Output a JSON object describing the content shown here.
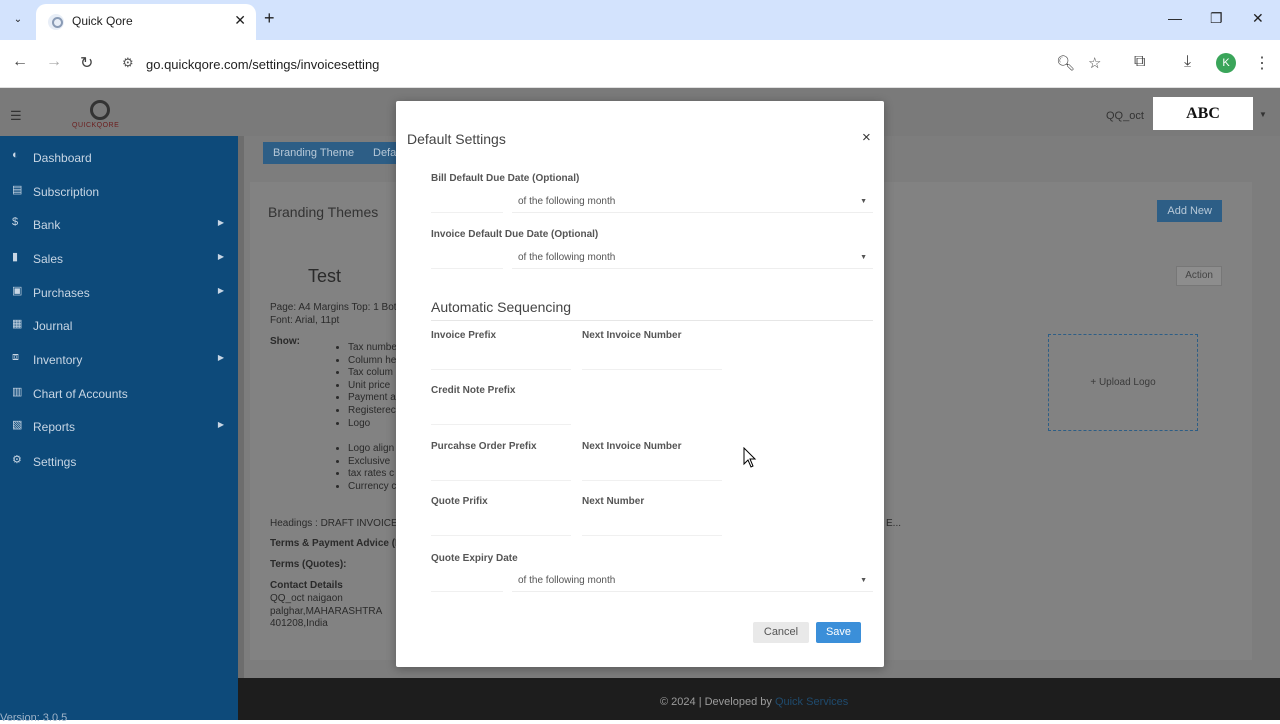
{
  "browser": {
    "tab_title": "Quick Qore",
    "url": "go.quickqore.com/settings/invoicesetting",
    "profile_initial": "K"
  },
  "app": {
    "logo_text": "QUICKQORE",
    "user_name": "QQ_oct",
    "company_badge": "ABC",
    "version": "Version: 3.0.5"
  },
  "sidebar": {
    "items": [
      {
        "label": "Dashboard",
        "icon": "dashboard-icon"
      },
      {
        "label": "Subscription",
        "icon": "subscription-icon"
      },
      {
        "label": "Bank",
        "icon": "dollar-icon"
      },
      {
        "label": "Sales",
        "icon": "bar-chart-icon"
      },
      {
        "label": "Purchases",
        "icon": "purchases-icon"
      },
      {
        "label": "Journal",
        "icon": "journal-icon"
      },
      {
        "label": "Inventory",
        "icon": "inventory-icon"
      },
      {
        "label": "Chart of Accounts",
        "icon": "accounts-icon"
      },
      {
        "label": "Reports",
        "icon": "reports-icon"
      },
      {
        "label": "Settings",
        "icon": "gear-icon"
      }
    ]
  },
  "content": {
    "tabs": [
      "Branding Theme",
      "Defa"
    ],
    "panel_title": "Branding Themes",
    "add_new": "Add New",
    "theme_name": "Test",
    "action": "Action",
    "page_line": "Page: A4 Margins Top: 1 Bot",
    "font_line": "Font: Arial, 11pt",
    "show_label": "Show:",
    "show_items": [
      "Tax numbe",
      "Column he",
      "Tax colum",
      "Unit price",
      "Payment a",
      "Registerec",
      "Logo"
    ],
    "show_items2": [
      "Logo align",
      "Exclusive",
      "tax rates c",
      "Currency c"
    ],
    "headings": "Headings : DRAFT INVOICE,",
    "headings_tail": "E...",
    "terms_payment": "Terms & Payment Advice (I",
    "terms_quotes": "Terms (Quotes):",
    "contact_title": "Contact Details",
    "contact_lines": [
      "QQ_oct naigaon",
      "palghar,MAHARASHTRA",
      "401208,India"
    ],
    "upload_logo": "+ Upload Logo"
  },
  "footer": {
    "text": "© 2024 | Developed by",
    "link": "Quick Services"
  },
  "modal": {
    "title": "Default Settings",
    "bill_due_label": "Bill Default Due Date (Optional)",
    "bill_due_select": "of the following month",
    "invoice_due_label": "Invoice Default Due Date (Optional)",
    "invoice_due_select": "of the following month",
    "section_title": "Automatic Sequencing",
    "invoice_prefix_label": "Invoice Prefix",
    "next_invoice_label": "Next Invoice Number",
    "credit_note_label": "Credit Note Prefix",
    "po_prefix_label": "Purcahse Order Prefix",
    "po_next_label": "Next Invoice Number",
    "quote_prefix_label": "Quote Prifix",
    "quote_next_label": "Next Number",
    "quote_expiry_label": "Quote Expiry Date",
    "quote_expiry_select": "of the following month",
    "cancel": "Cancel",
    "save": "Save"
  }
}
